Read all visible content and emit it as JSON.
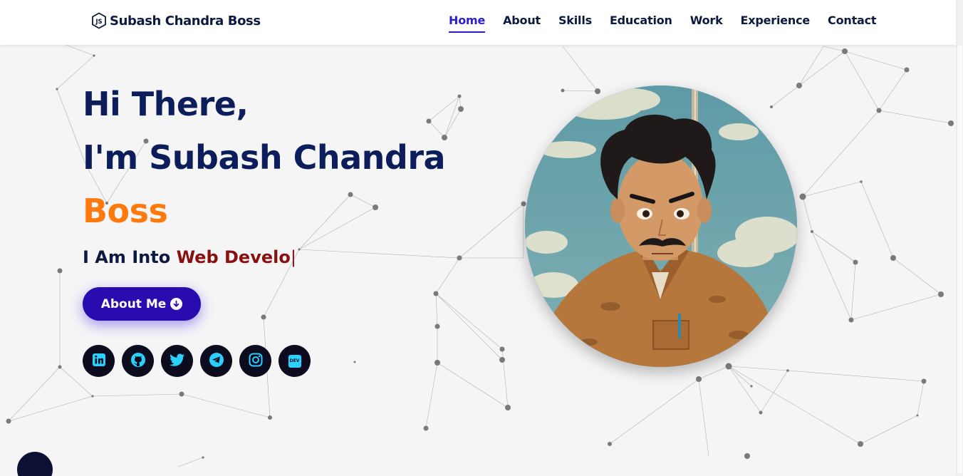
{
  "brand": {
    "name": "Subash Chandra Boss",
    "icon": "nodejs-icon"
  },
  "nav": {
    "items": [
      "Home",
      "About",
      "Skills",
      "Education",
      "Work",
      "Experience",
      "Contact"
    ],
    "active": "Home"
  },
  "hero": {
    "greeting": "Hi There,",
    "name_prefix": "I'm Subash Chandra",
    "name_accent": "Boss",
    "typing_prefix": "I Am Into",
    "typing_text": "Web Develo",
    "caret": "|",
    "about_button": "About Me",
    "about_button_icon": "arrow-down-circle-icon"
  },
  "socials": [
    {
      "name": "linkedin",
      "icon": "linkedin-icon"
    },
    {
      "name": "github",
      "icon": "github-icon"
    },
    {
      "name": "twitter",
      "icon": "twitter-icon"
    },
    {
      "name": "telegram",
      "icon": "telegram-icon"
    },
    {
      "name": "instagram",
      "icon": "instagram-icon"
    },
    {
      "name": "dev",
      "icon": "dev-icon",
      "label": "DEV"
    }
  ],
  "avatar": {
    "description_icon": "profile-avatar"
  },
  "colors": {
    "navy": "#0b1d5a",
    "accent_orange": "#ff7a0d",
    "accent_blue": "#2a1fd0",
    "button": "#2a0bb0",
    "typed_red": "#8b0f0f",
    "social_bg": "#0c0c1e",
    "social_icon": "#2ad1ff"
  }
}
